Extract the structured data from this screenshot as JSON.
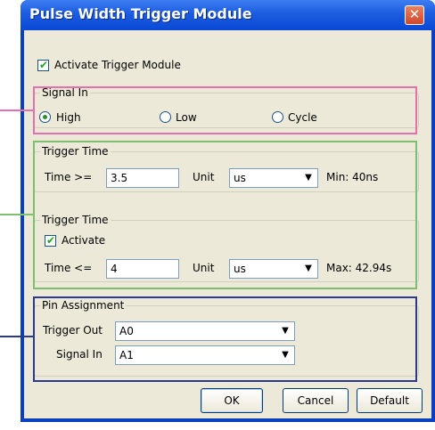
{
  "window": {
    "title": "Pulse Width Trigger Module",
    "close_glyph": "✕"
  },
  "activate_trigger": {
    "label": "Activate Trigger Module",
    "checked": true
  },
  "signal_in": {
    "legend": "Signal In",
    "options": [
      {
        "label": "High",
        "selected": true
      },
      {
        "label": "Low",
        "selected": false
      },
      {
        "label": "Cycle",
        "selected": false
      }
    ]
  },
  "trigger_time_1": {
    "legend": "Trigger Time",
    "time_label": "Time >=",
    "time_value": "3.5",
    "unit_label": "Unit",
    "unit_value": "us",
    "limit_text": "Min: 40ns"
  },
  "trigger_time_2": {
    "legend": "Trigger Time",
    "activate_label": "Activate",
    "activate_checked": true,
    "time_label": "Time <=",
    "time_value": "4",
    "unit_label": "Unit",
    "unit_value": "us",
    "limit_text": "Max: 42.94s"
  },
  "pin_assignment": {
    "legend": "Pin Assignment",
    "trigger_out_label": "Trigger Out",
    "trigger_out_value": "A0",
    "signal_in_label": "Signal In",
    "signal_in_value": "A1"
  },
  "buttons": {
    "ok": "OK",
    "cancel": "Cancel",
    "default": "Default"
  },
  "colors": {
    "titlebar": "#0a49d4",
    "client_bg": "#ece9d8",
    "highlight_pink": "#e76fae",
    "highlight_green": "#7dbf6a",
    "highlight_blue": "#2a3a8f"
  },
  "icons": {
    "dropdown": "chevron-down-icon",
    "close": "close-icon",
    "check": "check-icon"
  }
}
